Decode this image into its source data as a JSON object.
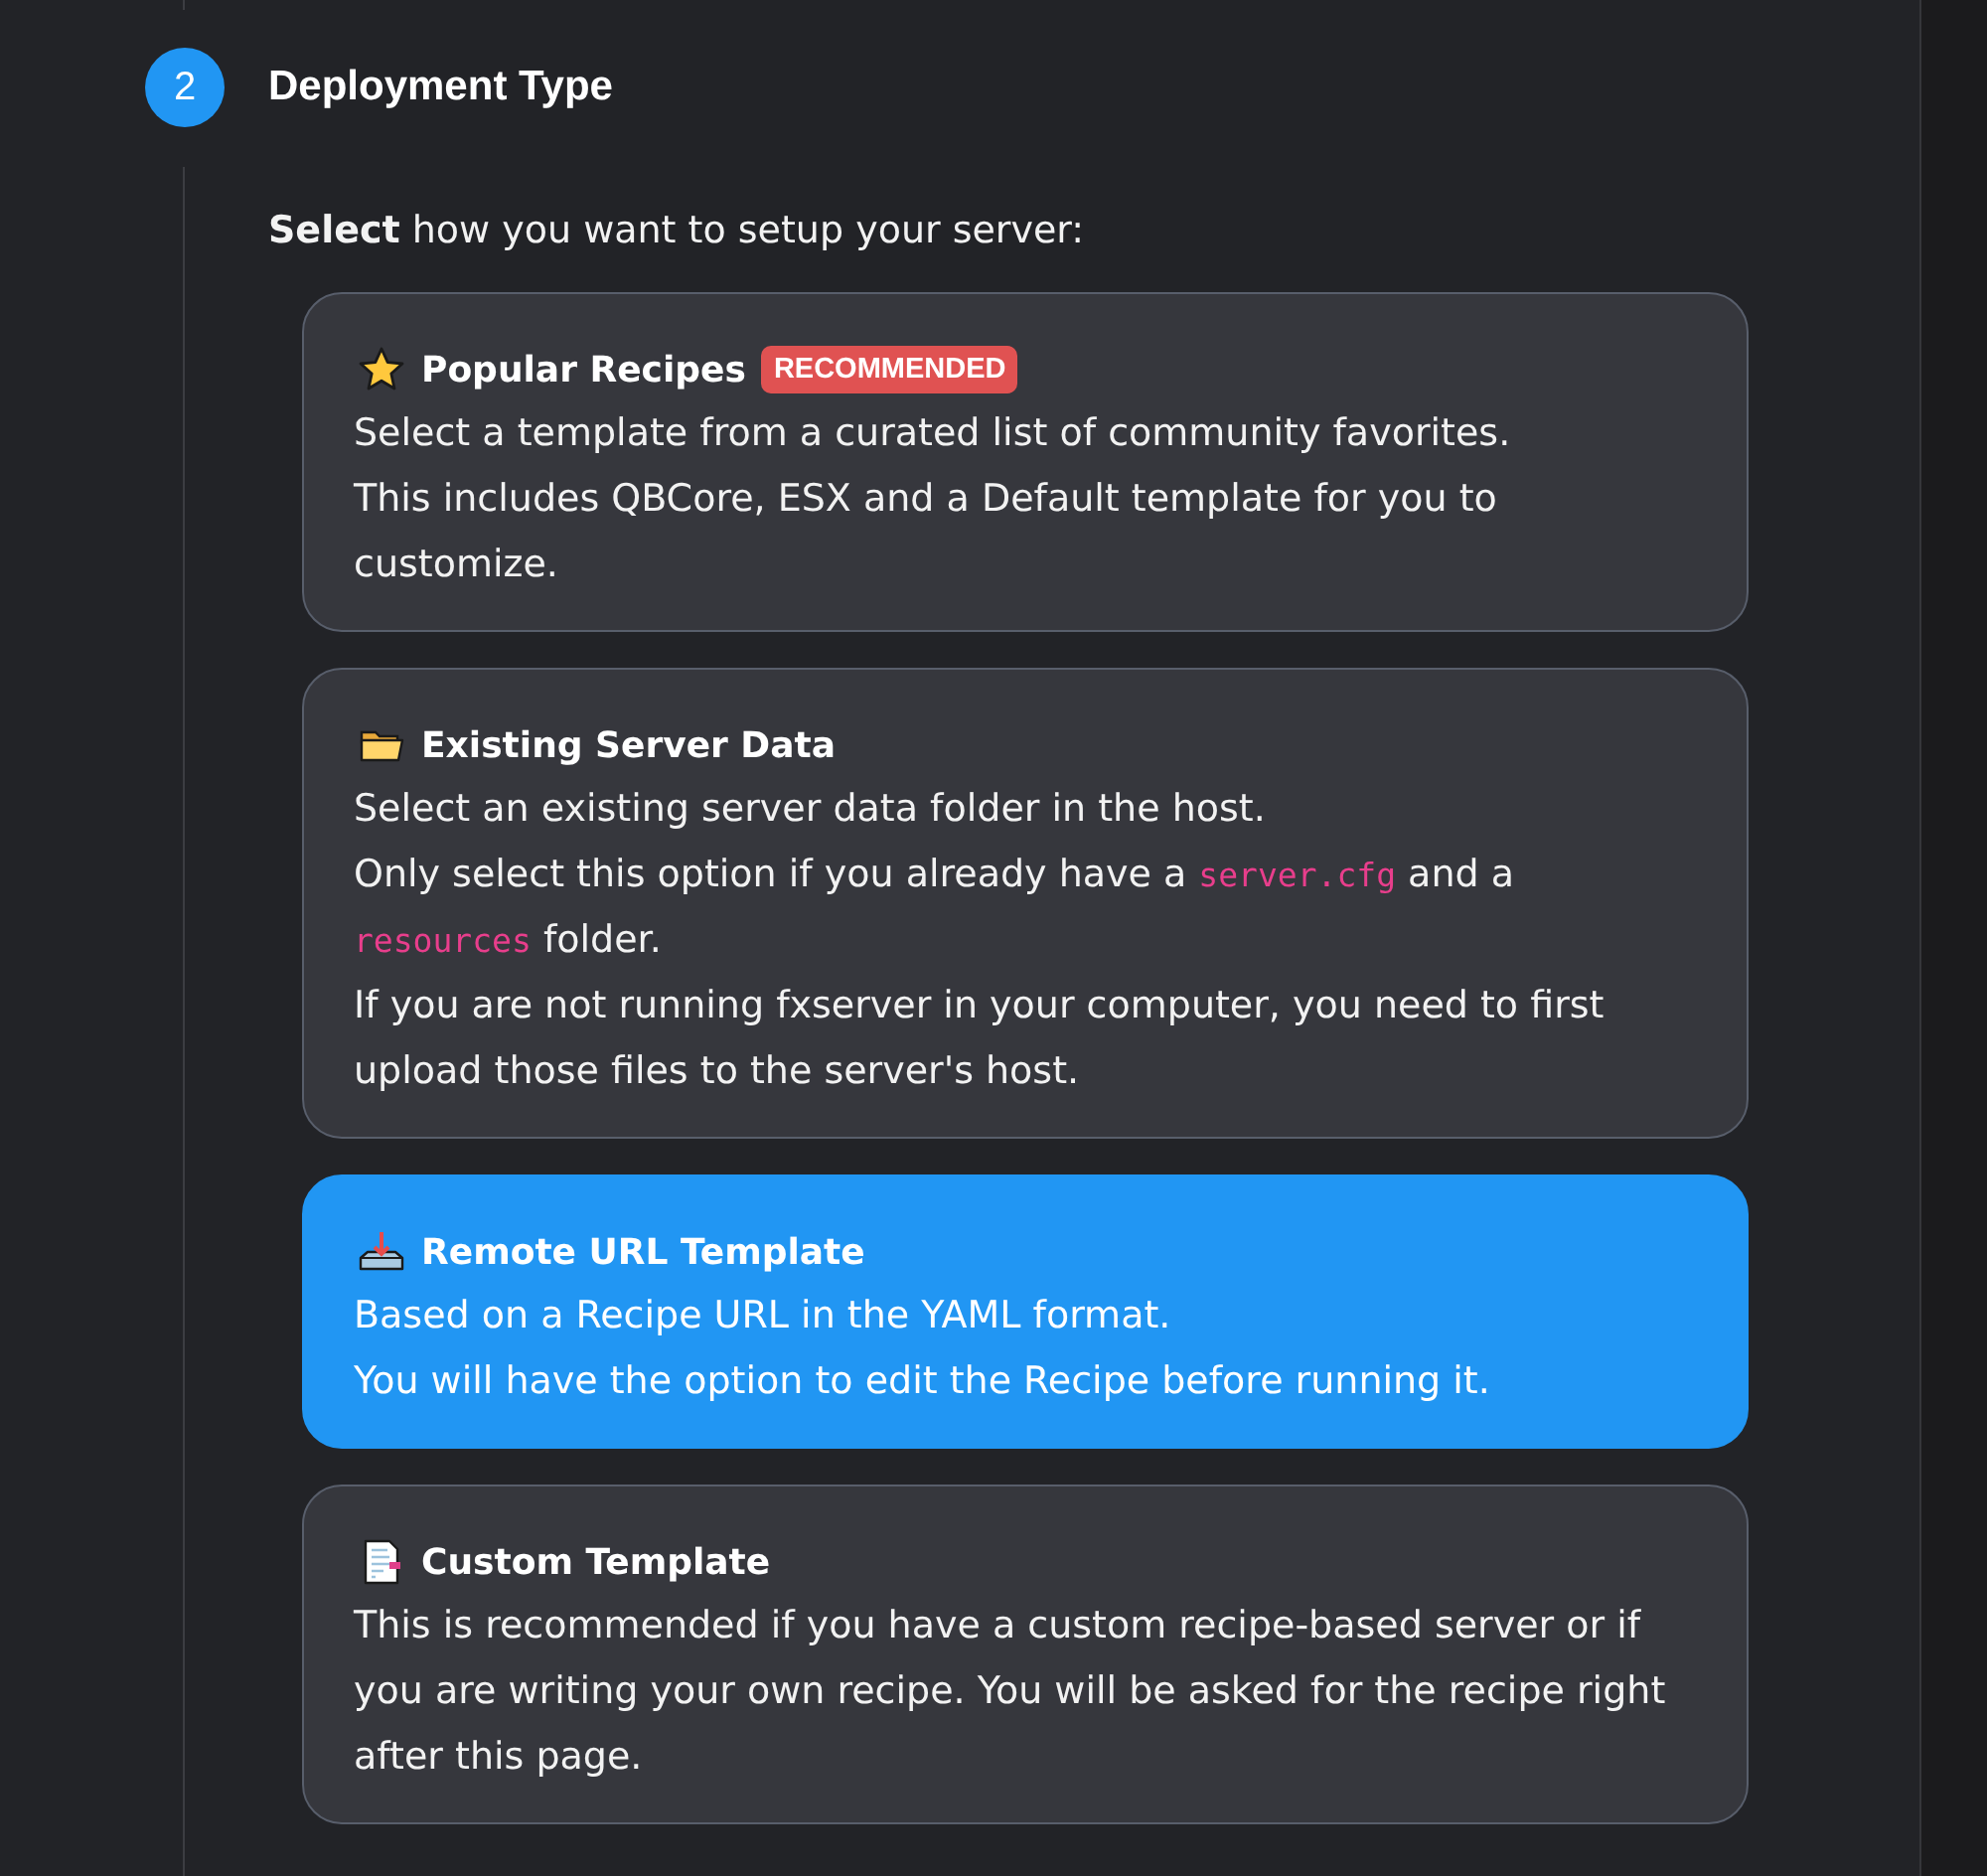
{
  "step": {
    "number": "2",
    "title": "Deployment Type"
  },
  "intro": "**Select** how you want to setup your server:",
  "options": [
    {
      "kind": "popular",
      "title": "Popular Recipes",
      "badge": "RECOMMENDED",
      "selected": false,
      "paragraphs": [
        [
          {
            "kind": "text",
            "text": "Select a template from a curated list of community favorites."
          }
        ],
        [
          {
            "kind": "text",
            "text": "This includes QBCore, ESX and a Default template for you to customize."
          }
        ]
      ]
    },
    {
      "kind": "existing",
      "title": "Existing Server Data",
      "selected": false,
      "paragraphs": [
        [
          {
            "kind": "text",
            "text": "Select an existing server data folder in the host."
          }
        ],
        [
          {
            "kind": "text",
            "text": "Only select this option if you already have a "
          },
          {
            "kind": "code",
            "text": "server.cfg"
          },
          {
            "kind": "text",
            "text": " and a "
          },
          {
            "kind": "code",
            "text": "resources"
          },
          {
            "kind": "text",
            "text": " folder."
          }
        ],
        [
          {
            "kind": "text",
            "text": "If you are not running fxserver in your computer, you need to first upload those files to the server's host."
          }
        ]
      ]
    },
    {
      "kind": "remote",
      "title": "Remote URL Template",
      "selected": true,
      "paragraphs": [
        [
          {
            "kind": "text",
            "text": "Based on a Recipe URL in the YAML format."
          }
        ],
        [
          {
            "kind": "text",
            "text": "You will have the option to edit the Recipe before running it."
          }
        ]
      ]
    },
    {
      "kind": "custom",
      "title": "Custom Template",
      "selected": false,
      "paragraphs": [
        [
          {
            "kind": "text",
            "text": "This is recommended if you have a custom recipe-based server or if you are writing your own recipe. You will be asked for the recipe right after this page."
          }
        ]
      ]
    }
  ]
}
